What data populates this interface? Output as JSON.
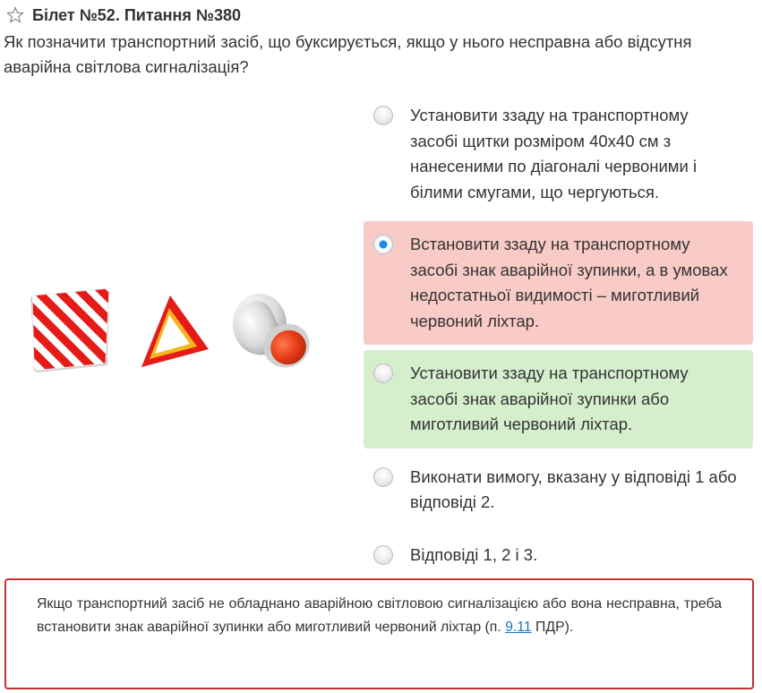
{
  "ticket_title": "Білет №52. Питання №380",
  "question": "Як позначити транспортний засіб, що буксирується, якщо у нього несправна або відсутня аварійна світлова сигналізація?",
  "illustration": {
    "items": [
      "striped-plate-icon",
      "warning-triangle-icon",
      "red-lamp-icon"
    ],
    "colors": {
      "red": "#e41b17",
      "white": "#ffffff",
      "yellow": "#f7b51f",
      "gray": "#c9c9c9"
    }
  },
  "answers": [
    {
      "text": "Установити ззаду на транспортному засобі щитки розміром 40x40 см з нанесеними по діагоналі червоними і білими смугами, що чергуються.",
      "state": "none"
    },
    {
      "text": "Встановити ззаду на транспортному засобі знак аварійної зупинки, а в умовах недостатньої видимості – миготливий червоний ліхтар.",
      "state": "selected-wrong"
    },
    {
      "text": "Установити ззаду на транспортному засобі знак аварійної зупинки або миготливий червоний ліхтар.",
      "state": "correct"
    },
    {
      "text": "Виконати вимогу, вказану у відповіді 1 або відповіді 2.",
      "state": "none"
    },
    {
      "text": "Відповіді 1, 2 і 3.",
      "state": "none"
    }
  ],
  "explanation": {
    "text": "Якщо транспортний засіб не обладнано аварійною світловою сигналізацією або вона несправна, треба встановити знак аварійної зупинки або миготливий червоний ліхтар (п. ",
    "link": "9.11",
    "tail": " ПДР)."
  },
  "colors": {
    "wrong_bg": "#f8cbc6",
    "correct_bg": "#d5efcd",
    "border": "#c53030",
    "link": "#1a73c8"
  }
}
